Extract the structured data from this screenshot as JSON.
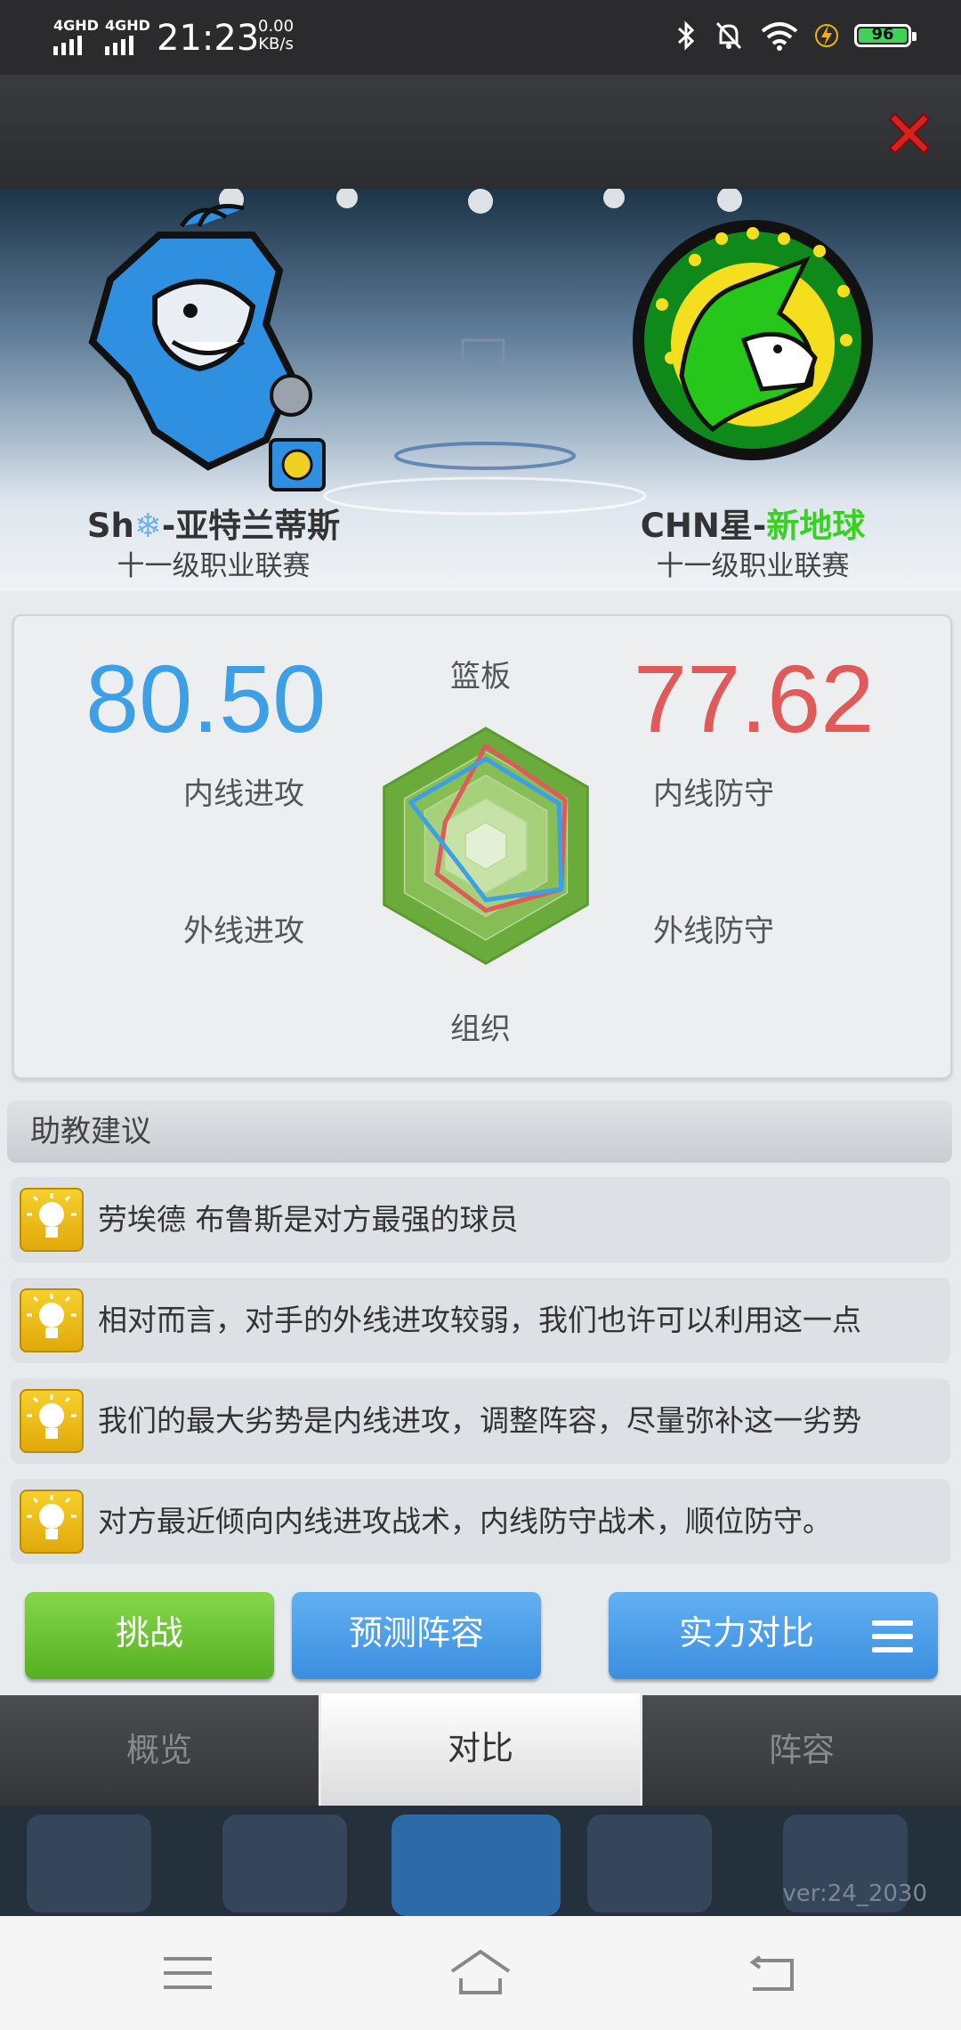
{
  "status_bar": {
    "signal1": "4GHD",
    "signal2": "4GHD",
    "time": "21:23",
    "net_speed_value": "0.00",
    "net_speed_unit": "KB/s",
    "battery": "96"
  },
  "header": {
    "close_icon": "close-x-icon"
  },
  "teams": {
    "home": {
      "name_prefix": "Sh",
      "name_suffix": "-亚特兰蒂斯",
      "league": "十一级职业联赛",
      "logo": "shark-basketball-logo"
    },
    "away": {
      "name_prefix": "CHN星-",
      "name_suffix": "新地球",
      "league": "十一级职业联赛",
      "logo": "unicorn-stars-logo"
    }
  },
  "comparison": {
    "home_score": "80.50",
    "away_score": "77.62",
    "home_color": "#3d9fe6",
    "away_color": "#e05a5a",
    "labels": {
      "top": "篮板",
      "left_top": "内线进攻",
      "left_bottom": "外线进攻",
      "right_top": "内线防守",
      "right_bottom": "外线防守",
      "bottom": "组织"
    },
    "chart_data": {
      "type": "radar",
      "axes": [
        "篮板",
        "内线防守",
        "外线防守",
        "组织",
        "外线进攻",
        "内线进攻"
      ],
      "series": [
        {
          "values": [
            0.85,
            0.78,
            0.74,
            0.55,
            0.48,
            0.4
          ]
        },
        {
          "values": [
            0.74,
            0.72,
            0.74,
            0.46,
            0.28,
            0.74
          ]
        }
      ]
    }
  },
  "advice": {
    "title": "助教建议",
    "items": [
      "劳埃德 布鲁斯是对方最强的球员",
      "相对而言，对手的外线进攻较弱，我们也许可以利用这一点",
      "我们的最大劣势是内线进攻，调整阵容，尽量弥补这一劣势",
      "对方最近倾向内线进攻战术，内线防守战术，顺位防守。"
    ]
  },
  "buttons": {
    "challenge": "挑战",
    "predict": "预测阵容",
    "strength": "实力对比"
  },
  "tabs": [
    "概览",
    "对比",
    "阵容"
  ],
  "version": "ver:24_2030"
}
